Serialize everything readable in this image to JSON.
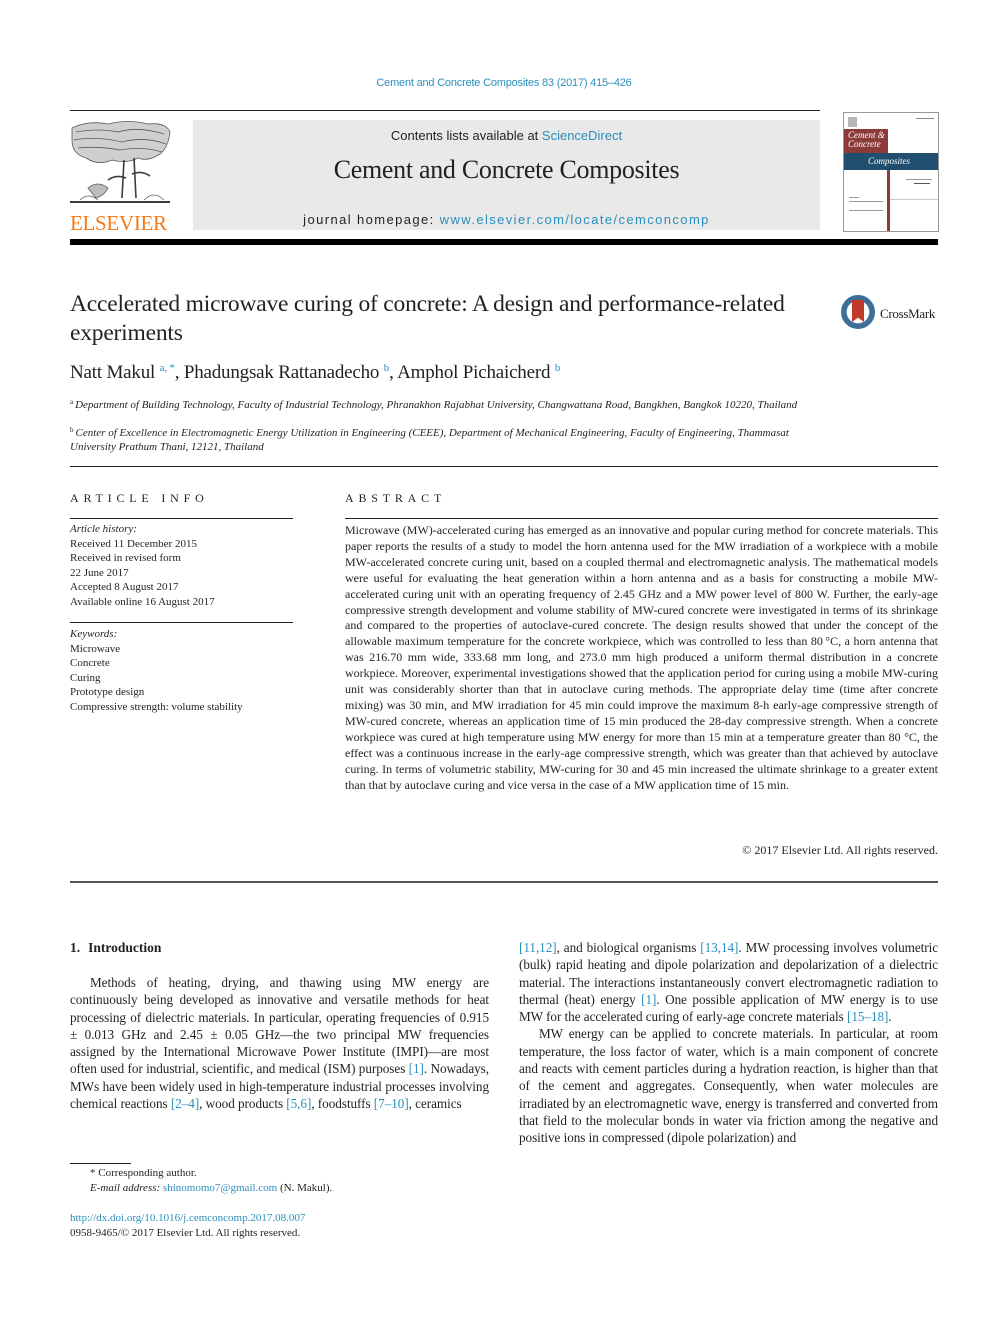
{
  "running_head": "Cement and Concrete Composites 83 (2017) 415–426",
  "masthead": {
    "publisher_logo_text": "ELSEVIER",
    "contents_prefix": "Contents lists available at ",
    "contents_link": "ScienceDirect",
    "journal_title": "Cement and Concrete Composites",
    "homepage_prefix": "journal homepage: ",
    "homepage_link": "www.elsevier.com/locate/cemconcomp",
    "cover": {
      "line1": "Cement &",
      "line2": "Concrete",
      "line3": "Composites"
    }
  },
  "article": {
    "title": "Accelerated microwave curing of concrete: A design and performance-related experiments",
    "crossmark_label": "CrossMark",
    "authors": [
      {
        "name": "Natt Makul",
        "sup": "a, *"
      },
      {
        "name": "Phadungsak Rattanadecho",
        "sup": "b"
      },
      {
        "name": "Amphol Pichaicherd",
        "sup": "b"
      }
    ],
    "affiliations": [
      {
        "key": "a",
        "text": "Department of Building Technology, Faculty of Industrial Technology, Phranakhon Rajabhat University, Changwattana Road, Bangkhen, Bangkok 10220, Thailand"
      },
      {
        "key": "b",
        "text": "Center of Excellence in Electromagnetic Energy Utilization in Engineering (CEEE), Department of Mechanical Engineering, Faculty of Engineering, Thammasat University Prathum Thani, 12121, Thailand"
      }
    ]
  },
  "article_info": {
    "heading": "ARTICLE INFO",
    "history_label": "Article history:",
    "history": [
      "Received 11 December 2015",
      "Received in revised form",
      "22 June 2017",
      "Accepted 8 August 2017",
      "Available online 16 August 2017"
    ],
    "keywords_label": "Keywords:",
    "keywords": [
      "Microwave",
      "Concrete",
      "Curing",
      "Prototype design",
      "Compressive strength: volume stability"
    ]
  },
  "abstract": {
    "heading": "ABSTRACT",
    "text": "Microwave (MW)-accelerated curing has emerged as an innovative and popular curing method for concrete materials. This paper reports the results of a study to model the horn antenna used for the MW irradiation of a workpiece with a mobile MW-accelerated concrete curing unit, based on a coupled thermal and electromagnetic analysis. The mathematical models were useful for evaluating the heat generation within a horn antenna and as a basis for constructing a mobile MW-accelerated curing unit with an operating frequency of 2.45 GHz and a MW power level of 800 W. Further, the early-age compressive strength development and volume stability of MW-cured concrete were investigated in terms of its shrinkage and compared to the properties of autoclave-cured concrete. The design results showed that under the concept of the allowable maximum temperature for the concrete workpiece, which was controlled to less than 80 °C, a horn antenna that was 216.70 mm wide, 333.68 mm long, and 273.0 mm high produced a uniform thermal distribution in a concrete workpiece. Moreover, experi­mental investigations showed that the application period for curing using a mobile MW-curing unit was considerably shorter than that in autoclave curing methods. The appropriate delay time (time after concrete mixing) was 30 min, and MW irradiation for 45 min could improve the maximum 8-h early-age compressive strength of MW-cured concrete, whereas an application time of 15 min produced the 28-day compressive strength. When a concrete workpiece was cured at high temperature using MW en­ergy for more than 15 min at a temperature greater than 80 °C, the effect was a continuous increase in the early-age compressive strength, which was greater than that achieved by autoclave curing. In terms of volumetric stability, MW-curing for 30 and 45 min increased the ultimate shrinkage to a greater extent than that by autoclave curing and vice versa in the case of a MW application time of 15 min.",
    "copyright": "© 2017 Elsevier Ltd. All rights reserved."
  },
  "introduction": {
    "number": "1.",
    "heading": "Introduction",
    "left_column": [
      {
        "t": "Methods of heating, drying, and thawing using MW energy are continuously being developed as innovative and versatile methods for heat processing of dielectric materials. In particular, operating frequencies of 0.915 ± 0.013 GHz and 2.45 ± 0.05 GHz—the two principal MW frequencies assigned by the International Microwave Power Institute (IMPI)—are most often used for industrial, scientific, and medical (ISM) purposes "
      },
      {
        "ref": "[1]"
      },
      {
        "t": ". Nowadays, MWs have been widely used in high-temperature industrial processes involving chemical reactions "
      },
      {
        "ref": "[2–4]"
      },
      {
        "t": ", wood products "
      },
      {
        "ref": "[5,6]"
      },
      {
        "t": ", foodstuffs "
      },
      {
        "ref": "[7–10]"
      },
      {
        "t": ", ceramics"
      }
    ],
    "right_column_p1": [
      {
        "ref": "[11,12]"
      },
      {
        "t": ", and biological organisms "
      },
      {
        "ref": "[13,14]"
      },
      {
        "t": ". MW processing involves volumetric (bulk) rapid heating and dipole polarization and de­polarization of a dielectric material. The interactions instanta­neously convert electromagnetic radiation to thermal (heat) energy "
      },
      {
        "ref": "[1]"
      },
      {
        "t": ". One possible application of MW energy is to use MW for the accelerated curing of early-age concrete materials "
      },
      {
        "ref": "[15–18]"
      },
      {
        "t": "."
      }
    ],
    "right_column_p2": "MW energy can be applied to concrete materials. In particular, at room temperature, the loss factor of water, which is a main component of concrete and reacts with cement particles during a hydration reaction, is higher than that of the cement and aggre­gates. Consequently, when water molecules are irradiated by an electromagnetic wave, energy is transferred and converted from that field to the molecular bonds in water via friction among the negative and positive ions in compressed (dipole polarization) and"
  },
  "footnotes": {
    "corresponding_mark": "*",
    "corresponding_text": "Corresponding author.",
    "email_label": "E-mail address:",
    "email": "shinomomo7@gmail.com",
    "email_suffix": " (N. Makul).",
    "doi": "http://dx.doi.org/10.1016/j.cemconcomp.2017.08.007",
    "issn_line": "0958-9465/© 2017 Elsevier Ltd. All rights reserved."
  },
  "colors": {
    "link": "#2a8fbd",
    "elsevier_orange": "#f27a1a",
    "masthead_gray": "#e9e9e9",
    "cover_red": "#8c3b3b",
    "cover_blue": "#1f4e6e"
  }
}
